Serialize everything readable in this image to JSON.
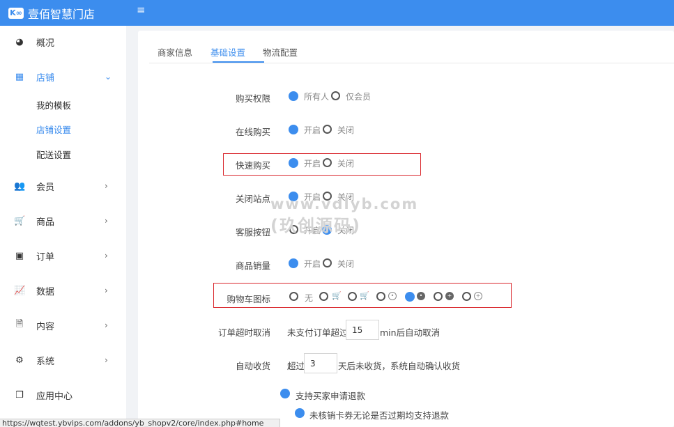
{
  "header": {
    "app_name": "壹佰智慧门店",
    "logo_mark": "K∞",
    "menu_icon": "≡"
  },
  "sidebar": {
    "items": [
      {
        "label": "概况",
        "icon": "dashboard-icon",
        "glyph": "◕"
      },
      {
        "label": "店铺",
        "icon": "grid-icon",
        "glyph": "▦",
        "expanded": true,
        "arrow": "⌄"
      },
      {
        "label": "会员",
        "icon": "users-icon",
        "glyph": "👥",
        "arrow": "›"
      },
      {
        "label": "商品",
        "icon": "cart-icon",
        "glyph": "🛒",
        "arrow": "›"
      },
      {
        "label": "订单",
        "icon": "money-icon",
        "glyph": "▣",
        "arrow": "›"
      },
      {
        "label": "数据",
        "icon": "chart-line-icon",
        "glyph": "📈",
        "arrow": "›"
      },
      {
        "label": "内容",
        "icon": "document-icon",
        "glyph": "🗎",
        "arrow": "›"
      },
      {
        "label": "系统",
        "icon": "gear-icon",
        "glyph": "⚙",
        "arrow": "›"
      },
      {
        "label": "应用中心",
        "icon": "cube-icon",
        "glyph": "❒"
      }
    ],
    "sub_items": [
      {
        "label": "我的模板"
      },
      {
        "label": "店铺设置",
        "active": true
      },
      {
        "label": "配送设置"
      }
    ]
  },
  "tabs": [
    {
      "label": "商家信息"
    },
    {
      "label": "基础设置",
      "active": true
    },
    {
      "label": "物流配置"
    }
  ],
  "form": {
    "buy_permission": {
      "label": "购买权限",
      "opt1": "所有人",
      "opt2": "仅会员",
      "selected": "所有人"
    },
    "online_buy": {
      "label": "在线购买",
      "opt1": "开启",
      "opt2": "关闭",
      "selected": "开启"
    },
    "quick_buy": {
      "label": "快速购买",
      "opt1": "开启",
      "opt2": "关闭",
      "selected": "开启"
    },
    "close_site": {
      "label": "关闭站点",
      "opt1": "开启",
      "opt2": "关闭",
      "selected": "开启"
    },
    "service_button": {
      "label": "客服按钮",
      "opt1": "开启",
      "opt2": "关闭",
      "selected": "关闭"
    },
    "product_sales": {
      "label": "商品销量",
      "opt1": "开启",
      "opt2": "关闭",
      "selected": "开启"
    },
    "cart_icon": {
      "label": "购物车图标",
      "none_label": "无",
      "selected_index": 4
    },
    "order_timeout": {
      "label": "订单超时取消",
      "prefix": "未支付订单超过",
      "value": "15",
      "suffix": "min后自动取消"
    },
    "auto_receive": {
      "label": "自动收货",
      "prefix": "超过",
      "value": "3",
      "suffix": "天后未收货，系统自动确认收货"
    },
    "refund": {
      "option1": "支持买家申请退款",
      "option2": "未核销卡券无论是否过期均支持退款"
    }
  },
  "watermark": {
    "line1": "www.vdlyb.com",
    "line2": "(玖创源码)"
  },
  "status_url": "https://wqtest.ybvips.com/addons/yb_shopv2/core/index.php#home",
  "colors": {
    "primary": "#3c8dee",
    "highlight_box": "#d9262c"
  }
}
